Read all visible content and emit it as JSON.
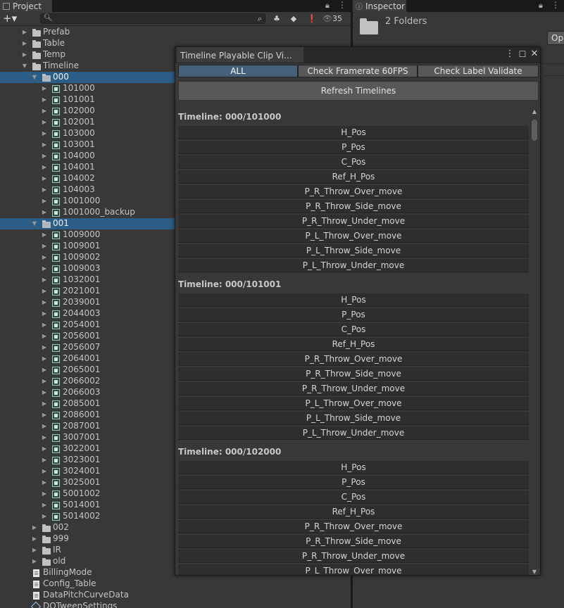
{
  "project": {
    "tab_label": "Project",
    "add_label": "+▾",
    "hidden_count": "35",
    "tree": [
      {
        "depth": 1,
        "kind": "folder",
        "arrow": "right",
        "label": "Prefab"
      },
      {
        "depth": 1,
        "kind": "folder",
        "arrow": "right",
        "label": "Table"
      },
      {
        "depth": 1,
        "kind": "folder",
        "arrow": "right",
        "label": "Temp"
      },
      {
        "depth": 1,
        "kind": "folder",
        "arrow": "down",
        "label": "Timeline"
      },
      {
        "depth": 2,
        "kind": "folder-open",
        "arrow": "down",
        "label": "000",
        "selected": true
      },
      {
        "depth": 3,
        "kind": "timeline",
        "arrow": "right",
        "label": "101000"
      },
      {
        "depth": 3,
        "kind": "timeline",
        "arrow": "right",
        "label": "101001"
      },
      {
        "depth": 3,
        "kind": "timeline",
        "arrow": "right",
        "label": "102000"
      },
      {
        "depth": 3,
        "kind": "timeline",
        "arrow": "right",
        "label": "102001"
      },
      {
        "depth": 3,
        "kind": "timeline",
        "arrow": "right",
        "label": "103000"
      },
      {
        "depth": 3,
        "kind": "timeline",
        "arrow": "right",
        "label": "103001"
      },
      {
        "depth": 3,
        "kind": "timeline",
        "arrow": "right",
        "label": "104000"
      },
      {
        "depth": 3,
        "kind": "timeline",
        "arrow": "right",
        "label": "104001"
      },
      {
        "depth": 3,
        "kind": "timeline",
        "arrow": "right",
        "label": "104002"
      },
      {
        "depth": 3,
        "kind": "timeline",
        "arrow": "right",
        "label": "104003"
      },
      {
        "depth": 3,
        "kind": "timeline",
        "arrow": "right",
        "label": "1001000"
      },
      {
        "depth": 3,
        "kind": "timeline",
        "arrow": "right",
        "label": "1001000_backup"
      },
      {
        "depth": 2,
        "kind": "folder-open",
        "arrow": "down",
        "label": "001",
        "selected": true
      },
      {
        "depth": 3,
        "kind": "timeline",
        "arrow": "right",
        "label": "1009000"
      },
      {
        "depth": 3,
        "kind": "timeline",
        "arrow": "right",
        "label": "1009001"
      },
      {
        "depth": 3,
        "kind": "timeline",
        "arrow": "right",
        "label": "1009002"
      },
      {
        "depth": 3,
        "kind": "timeline",
        "arrow": "right",
        "label": "1009003"
      },
      {
        "depth": 3,
        "kind": "timeline",
        "arrow": "right",
        "label": "1032001"
      },
      {
        "depth": 3,
        "kind": "timeline",
        "arrow": "right",
        "label": "2021001"
      },
      {
        "depth": 3,
        "kind": "timeline",
        "arrow": "right",
        "label": "2039001"
      },
      {
        "depth": 3,
        "kind": "timeline",
        "arrow": "right",
        "label": "2044003"
      },
      {
        "depth": 3,
        "kind": "timeline",
        "arrow": "right",
        "label": "2054001"
      },
      {
        "depth": 3,
        "kind": "timeline",
        "arrow": "right",
        "label": "2056001"
      },
      {
        "depth": 3,
        "kind": "timeline",
        "arrow": "right",
        "label": "2056007"
      },
      {
        "depth": 3,
        "kind": "timeline",
        "arrow": "right",
        "label": "2064001"
      },
      {
        "depth": 3,
        "kind": "timeline",
        "arrow": "right",
        "label": "2065001"
      },
      {
        "depth": 3,
        "kind": "timeline",
        "arrow": "right",
        "label": "2066002"
      },
      {
        "depth": 3,
        "kind": "timeline",
        "arrow": "right",
        "label": "2066003"
      },
      {
        "depth": 3,
        "kind": "timeline",
        "arrow": "right",
        "label": "2085001"
      },
      {
        "depth": 3,
        "kind": "timeline",
        "arrow": "right",
        "label": "2086001"
      },
      {
        "depth": 3,
        "kind": "timeline",
        "arrow": "right",
        "label": "2087001"
      },
      {
        "depth": 3,
        "kind": "timeline",
        "arrow": "right",
        "label": "3007001"
      },
      {
        "depth": 3,
        "kind": "timeline",
        "arrow": "right",
        "label": "3022001"
      },
      {
        "depth": 3,
        "kind": "timeline",
        "arrow": "right",
        "label": "3023001"
      },
      {
        "depth": 3,
        "kind": "timeline",
        "arrow": "right",
        "label": "3024001"
      },
      {
        "depth": 3,
        "kind": "timeline",
        "arrow": "right",
        "label": "3025001"
      },
      {
        "depth": 3,
        "kind": "timeline",
        "arrow": "right",
        "label": "5001002"
      },
      {
        "depth": 3,
        "kind": "timeline",
        "arrow": "right",
        "label": "5014001"
      },
      {
        "depth": 3,
        "kind": "timeline",
        "arrow": "right",
        "label": "5014002"
      },
      {
        "depth": 2,
        "kind": "folder",
        "arrow": "right",
        "label": "002"
      },
      {
        "depth": 2,
        "kind": "folder",
        "arrow": "right",
        "label": "999"
      },
      {
        "depth": 2,
        "kind": "folder",
        "arrow": "right",
        "label": "IR"
      },
      {
        "depth": 2,
        "kind": "folder",
        "arrow": "right",
        "label": "old"
      },
      {
        "depth": 1,
        "kind": "doc",
        "arrow": "",
        "label": "BillingMode"
      },
      {
        "depth": 1,
        "kind": "doc",
        "arrow": "",
        "label": "Config_Table"
      },
      {
        "depth": 1,
        "kind": "doc",
        "arrow": "",
        "label": "DataPitchCurveData"
      },
      {
        "depth": 1,
        "kind": "asset",
        "arrow": "",
        "label": "DOTweenSettings"
      }
    ]
  },
  "inspector": {
    "tab_label": "Inspector",
    "selection_label": "2 Folders",
    "open_button": "Ope"
  },
  "timeline_window": {
    "title": "Timeline Playable Clip Vi...",
    "tabs": [
      "ALL",
      "Check Framerate 60FPS",
      "Check Label Validate"
    ],
    "active_tab": 0,
    "refresh_label": "Refresh Timelines",
    "groups": [
      {
        "title": "Timeline: 000/101000",
        "clips": [
          "H_Pos",
          "P_Pos",
          "C_Pos",
          "Ref_H_Pos",
          "P_R_Throw_Over_move",
          "P_R_Throw_Side_move",
          "P_R_Throw_Under_move",
          "P_L_Throw_Over_move",
          "P_L_Throw_Side_move",
          "P_L_Throw_Under_move"
        ]
      },
      {
        "title": "Timeline: 000/101001",
        "clips": [
          "H_Pos",
          "P_Pos",
          "C_Pos",
          "Ref_H_Pos",
          "P_R_Throw_Over_move",
          "P_R_Throw_Side_move",
          "P_R_Throw_Under_move",
          "P_L_Throw_Over_move",
          "P_L_Throw_Side_move",
          "P_L_Throw_Under_move"
        ]
      },
      {
        "title": "Timeline: 000/102000",
        "clips": [
          "H_Pos",
          "P_Pos",
          "C_Pos",
          "Ref_H_Pos",
          "P_R_Throw_Over_move",
          "P_R_Throw_Side_move",
          "P_R_Throw_Under_move",
          "P_L_Throw_Over_move"
        ]
      }
    ]
  }
}
